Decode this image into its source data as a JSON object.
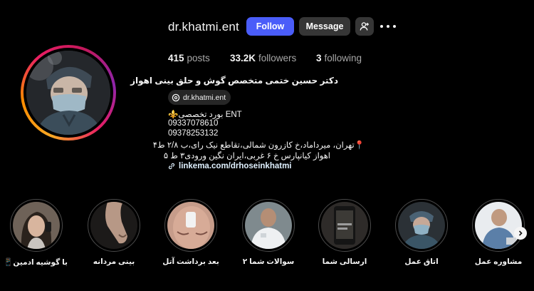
{
  "profile": {
    "username": "dr.khatmi.ent",
    "follow_label": "Follow",
    "message_label": "Message",
    "stats": {
      "posts_count": "415",
      "posts_label": "posts",
      "followers_count": "33.2K",
      "followers_label": "followers",
      "following_count": "3",
      "following_label": "following"
    },
    "full_name": "دکتر حسین ختمی متخصص گوش و حلق بینی اهواز",
    "threads_handle": "dr.khatmi.ent",
    "bio": {
      "line1": "⚜️بورد تخصصی ENT",
      "phone1": "09337078610",
      "phone2": "09378253132",
      "address1": "📍تهران، میرداماد،خ کازرون شمالی،تقاطع نیک رای،ب ۲/۸ ط۴",
      "address2": "اهواز کیانپارس خ ۶ غربی،ایران نگین ورودی۳ ط ۵"
    },
    "link": "linkema.com/drhoseinkhatmi"
  },
  "highlights": [
    {
      "label": "با گوشیه ادمین📱"
    },
    {
      "label": "بینی مردانه"
    },
    {
      "label": "بعد برداشت آتل"
    },
    {
      "label": "سوالات شما ۲"
    },
    {
      "label": "ارسالی شما"
    },
    {
      "label": "اتاق عمل"
    },
    {
      "label": "مشاوره عمل"
    }
  ],
  "colors": {
    "follow_button": "#4a5df9",
    "secondary_button": "#363636",
    "background": "#000000"
  },
  "icons": [
    "suggest-user-icon",
    "more-icon",
    "threads-icon",
    "link-icon",
    "chevron-right-icon"
  ]
}
